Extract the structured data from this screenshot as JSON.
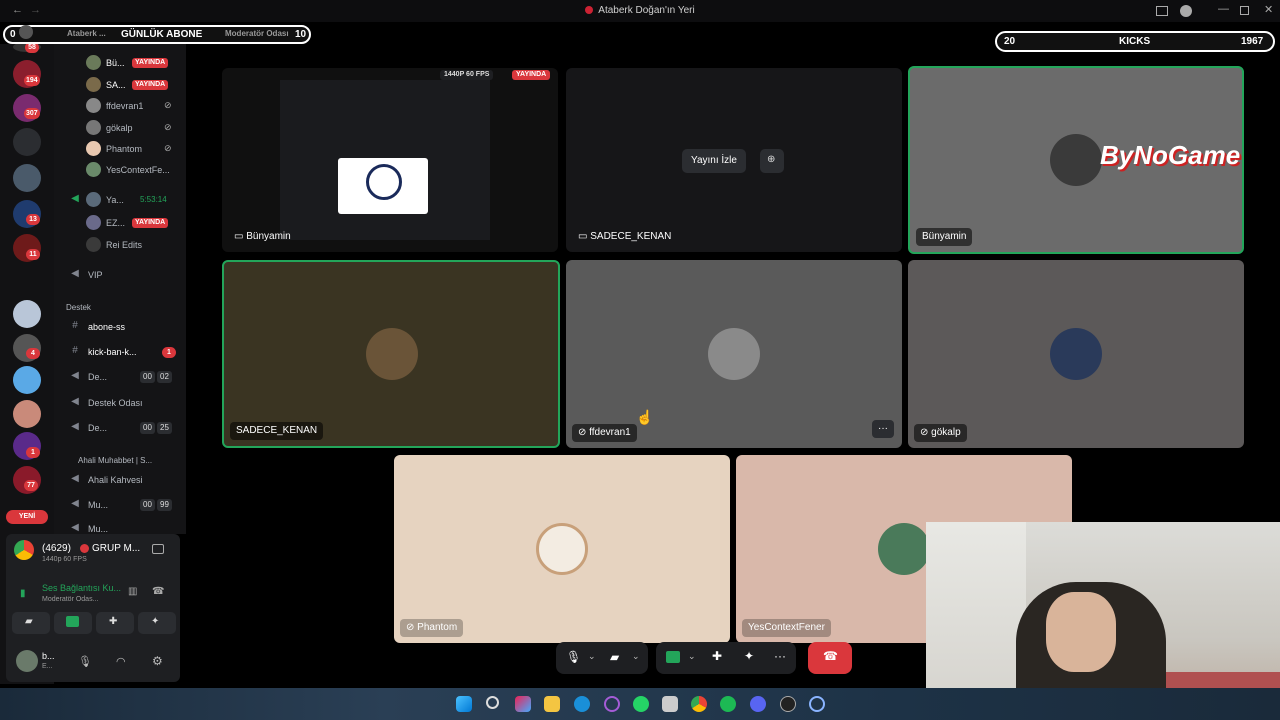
{
  "window": {
    "title": "Ataberk Doğan'ın Yeri",
    "back": "←",
    "forward": "→"
  },
  "overlay_left": {
    "left_num": "0",
    "label": "GÜNLÜK ABONE",
    "right_num": "10"
  },
  "overlay_right": {
    "left_num": "20",
    "label": "KICKS",
    "right_num": "1967"
  },
  "header_channels": {
    "server": "Ataberk ...",
    "voice": "Moderatör Odası"
  },
  "server_badges": [
    "58",
    "194",
    "307",
    "13",
    "11",
    "4",
    "1",
    "77"
  ],
  "voice_users": [
    {
      "name": "Bü...",
      "live": "YAYINDA"
    },
    {
      "name": "SA...",
      "live": "YAYINDA"
    },
    {
      "name": "ffdevran1",
      "live": ""
    },
    {
      "name": "gökalp",
      "live": ""
    },
    {
      "name": "Phantom",
      "live": ""
    },
    {
      "name": "YesContextFe...",
      "live": ""
    }
  ],
  "channels": {
    "voice_ya": {
      "name": "Ya...",
      "time": "5:53:14"
    },
    "ez": {
      "name": "EZ...",
      "live": "YAYINDA"
    },
    "rei": "Rei Edits",
    "vip": "VIP",
    "category_destek": "Destek",
    "abone": "abone-ss",
    "kickban": "kick-ban-k...",
    "kickban_badge": "1",
    "de1": {
      "name": "De...",
      "a": "00",
      "b": "02"
    },
    "destek_odasi": "Destek Odası",
    "de2": {
      "name": "De...",
      "a": "00",
      "b": "25"
    },
    "category_ahali": "Ahali Muhabbet | S...",
    "ahali_kahvesi": "Ahali Kahvesi",
    "mu1": {
      "name": "Mu...",
      "a": "00",
      "b": "99"
    },
    "mu2": {
      "name": "Mu..."
    }
  },
  "yeni": "YENİ",
  "user_panel": {
    "stream_count": "(4629)",
    "stream_title": "GRUP M...",
    "stream_quality": "1440p 60 FPS",
    "voice_status": "Ses Bağlantısı Ku...",
    "voice_channel": "Moderatör Odas...",
    "username": "b...",
    "status": "E..."
  },
  "tiles": {
    "t1": {
      "name": "Bünyamin",
      "badge_quality": "1440P 60 FPS",
      "badge_live": "YAYINDA"
    },
    "t2": {
      "name": "SADECE_KENAN",
      "watch": "Yayını İzle"
    },
    "t3": {
      "name": "Bünyamin",
      "logo": "ByNoGame"
    },
    "t4": {
      "name": "SADECE_KENAN"
    },
    "t5": {
      "name": "ffdevran1",
      "more": "···"
    },
    "t6": {
      "name": "gökalp"
    },
    "t7": {
      "name": "Phantom"
    },
    "t8": {
      "name": "YesContextFener"
    }
  },
  "controls": {
    "more": "···"
  },
  "colors": {
    "live_red": "#da373c",
    "speaking_green": "#23a55a",
    "bg": "#000000"
  }
}
